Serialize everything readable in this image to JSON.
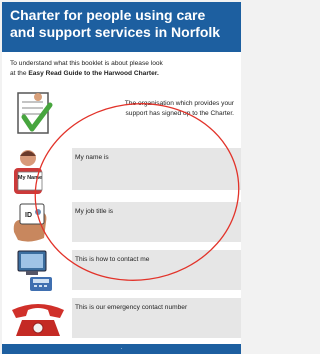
{
  "header": {
    "title_line1": "Charter for people using care",
    "title_line2": "and support services in Norfolk"
  },
  "intro": {
    "line1": "To understand what this booklet is about please  look",
    "line2_prefix": "at the ",
    "line2_bold": "Easy Read Guide to the Harwood Charter."
  },
  "signed": {
    "line1": "The organisation which provides your",
    "line2": "support has signed up to the Charter."
  },
  "rows": [
    {
      "label": "My name is",
      "icon": "name-badge-icon",
      "badge_text": "My Name"
    },
    {
      "label": "My job title is",
      "icon": "id-card-icon",
      "badge_text": "ID"
    },
    {
      "label": "This is how to contact me",
      "icon": "computer-phone-icon"
    },
    {
      "label": "This is our emergency contact number",
      "icon": "telephone-icon"
    }
  ],
  "colors": {
    "brand_blue": "#1d5fa0",
    "circle_red": "#e2332a",
    "check_green": "#47a53e"
  }
}
